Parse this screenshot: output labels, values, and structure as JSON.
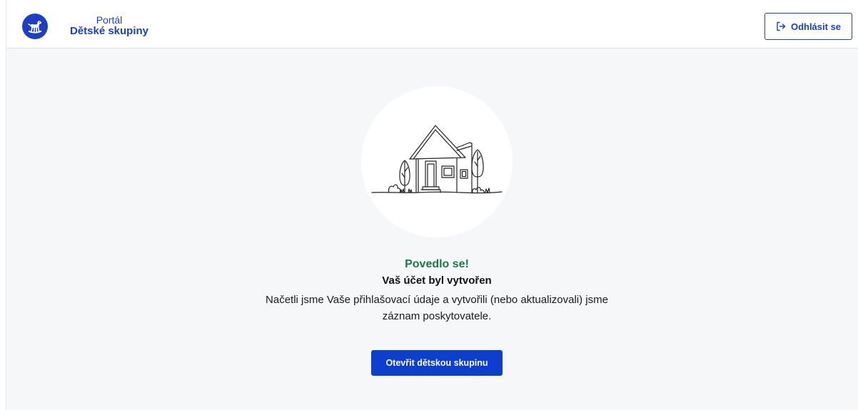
{
  "header": {
    "logo": {
      "icon": "rocking-horse-icon"
    },
    "portal_label": "Portál",
    "app_name": "Dětské skupiny",
    "logout": {
      "label": "Odhlásit se",
      "icon": "logout-icon"
    }
  },
  "main": {
    "illustration_icon": "house-illustration",
    "success_title": "Povedlo se!",
    "heading": "Vaš účet byl vytvořen",
    "message": "Načetli jsme Vaše přihlašovací údaje a vytvořili (nebo aktualizovali) jsme záznam poskytovatele.",
    "primary_button": {
      "label": "Otevřit dětskou skupinu"
    }
  },
  "colors": {
    "brand": "#1b3fc6",
    "success": "#177a47",
    "primary": "#0c3fd1",
    "page_background": "#f6f7f9",
    "text": "#1a1a1a"
  }
}
